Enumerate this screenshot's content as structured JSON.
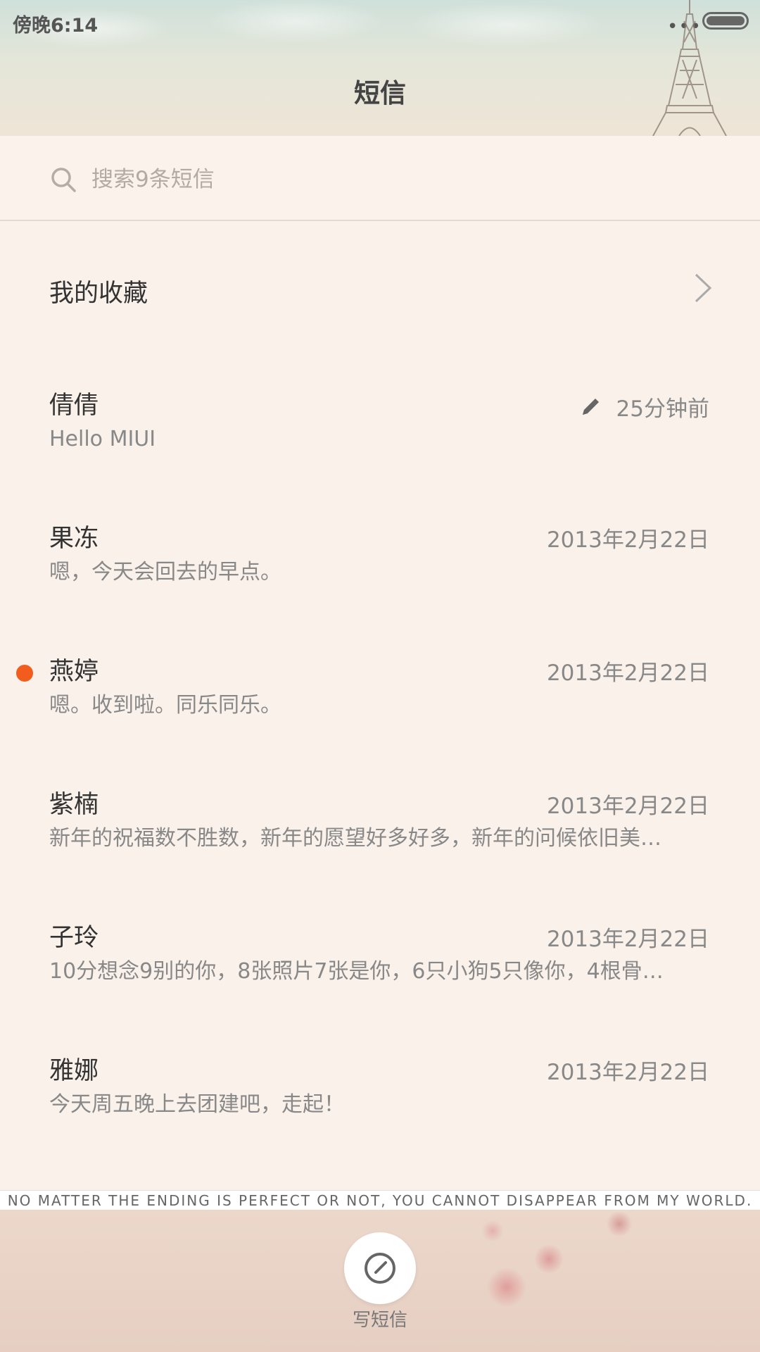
{
  "status_bar": {
    "time": "傍晚6:14",
    "more": "•••"
  },
  "header": {
    "title": "短信"
  },
  "search": {
    "placeholder": "搜索9条短信"
  },
  "favorites": {
    "label": "我的收藏"
  },
  "conversations": [
    {
      "name": "倩倩",
      "preview": "Hello MIUI",
      "time": "25分钟前",
      "draft": true,
      "unread": false
    },
    {
      "name": "果冻",
      "preview": "嗯，今天会回去的早点。",
      "time": "2013年2月22日",
      "draft": false,
      "unread": false
    },
    {
      "name": "燕婷",
      "preview": "嗯。收到啦。同乐同乐。",
      "time": "2013年2月22日",
      "draft": false,
      "unread": true
    },
    {
      "name": "紫楠",
      "preview": "新年的祝福数不胜数，新年的愿望好多好多，新年的问候依旧美…",
      "time": "2013年2月22日",
      "draft": false,
      "unread": false
    },
    {
      "name": "子玲",
      "preview": "10分想念9别的你，8张照片7张是你，6只小狗5只像你，4根骨…",
      "time": "2013年2月22日",
      "draft": false,
      "unread": false
    },
    {
      "name": "雅娜",
      "preview": "今天周五晚上去团建吧，走起！",
      "time": "2013年2月22日",
      "draft": false,
      "unread": false
    }
  ],
  "tagline": "NO MATTER THE ENDING IS PERFECT OR NOT, YOU CANNOT DISAPPEAR FROM MY WORLD.",
  "compose": {
    "label": "写短信"
  },
  "colors": {
    "unread_dot": "#f25c1c",
    "background": "#f9f1ea"
  }
}
